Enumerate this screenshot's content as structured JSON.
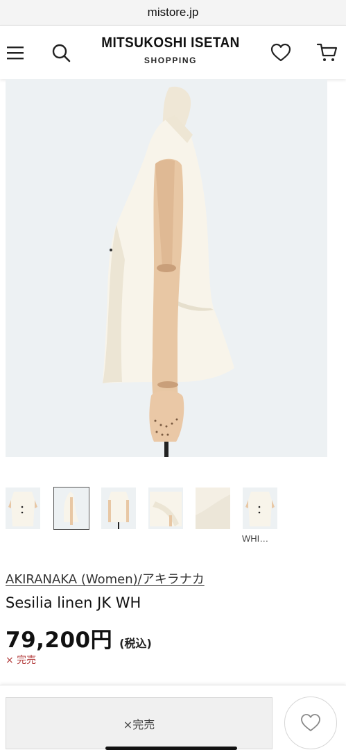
{
  "browser": {
    "url": "mistore.jp"
  },
  "header": {
    "logo_main": "MITSUKOSHI ISETAN",
    "logo_sub": "SHOPPING",
    "icons": {
      "menu": "hamburger-menu-icon",
      "search": "search-icon",
      "wishlist": "heart-icon",
      "cart": "cart-icon"
    }
  },
  "product": {
    "brand": "AKIRANAKA (Women)/アキラナカ",
    "name": "Sesilia linen JK WH",
    "price": "79,200円",
    "tax_note": "(税込)",
    "stock_status": "× 完売",
    "thumbnails": [
      {
        "label": "front view"
      },
      {
        "label": "side view",
        "selected": true
      },
      {
        "label": "back view"
      },
      {
        "label": "drape detail"
      },
      {
        "label": "fabric close-up"
      },
      {
        "label": "color swatch",
        "caption": "WHI…"
      }
    ]
  },
  "bottom_bar": {
    "soldout_button": "×完売",
    "favorite_icon": "heart-outline-icon"
  },
  "colors": {
    "image_bg": "#edf1f3",
    "garment": "#f7f3ea",
    "soldout_red": "#b23a3a"
  }
}
